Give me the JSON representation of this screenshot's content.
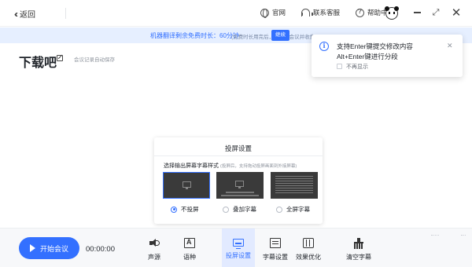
{
  "titlebar": {
    "back_label": "返回",
    "nav": [
      {
        "label": "官网",
        "icon": "globe-icon"
      },
      {
        "label": "联系客服",
        "icon": "headset-icon"
      },
      {
        "label": "帮助中心",
        "icon": "help-icon"
      }
    ],
    "avatar_icon": "panda-avatar-icon",
    "window_controls": [
      "minimize-icon",
      "maximize-icon",
      "close-icon"
    ]
  },
  "banner": {
    "text": "机器翻译剩余免费时长：60分钟",
    "note": "(免费时长用完后，将继续会议并收费)",
    "button": "继续"
  },
  "document": {
    "title": "下载吧",
    "autosave": "会议记录自动保存"
  },
  "toast": {
    "line1": "支持Enter键提交修改内容",
    "line2": "Alt+Enter键进行分段",
    "checkbox_label": "不再显示",
    "checkbox_checked": false
  },
  "projection_panel": {
    "title": "投屏设置",
    "choose_label": "选择输出屏幕字幕样式",
    "choose_hint": "(投屏后，支持拖动投屏画面到外接屏幕)",
    "options": [
      {
        "label": "不投屏",
        "selected": true
      },
      {
        "label": "叠加字幕",
        "selected": false
      },
      {
        "label": "全屏字幕",
        "selected": false
      }
    ]
  },
  "toolbar": {
    "start_label": "开始会议",
    "timer": "00:00:00",
    "tools": [
      {
        "label": "声源",
        "icon": "speaker-icon",
        "active": false
      },
      {
        "label": "语种",
        "icon": "language-icon",
        "active": false
      },
      {
        "label": "投屏设置",
        "icon": "screen-cast-icon",
        "active": true
      },
      {
        "label": "字幕设置",
        "icon": "subtitle-icon",
        "active": false
      },
      {
        "label": "效果优化",
        "icon": "sliders-icon",
        "active": false
      },
      {
        "label": "清空字幕",
        "icon": "broom-icon",
        "active": false
      }
    ]
  },
  "colors": {
    "accent": "#3370ff",
    "banner_bg": "#e6efff",
    "toolbar_bg": "#f7f8fa"
  }
}
